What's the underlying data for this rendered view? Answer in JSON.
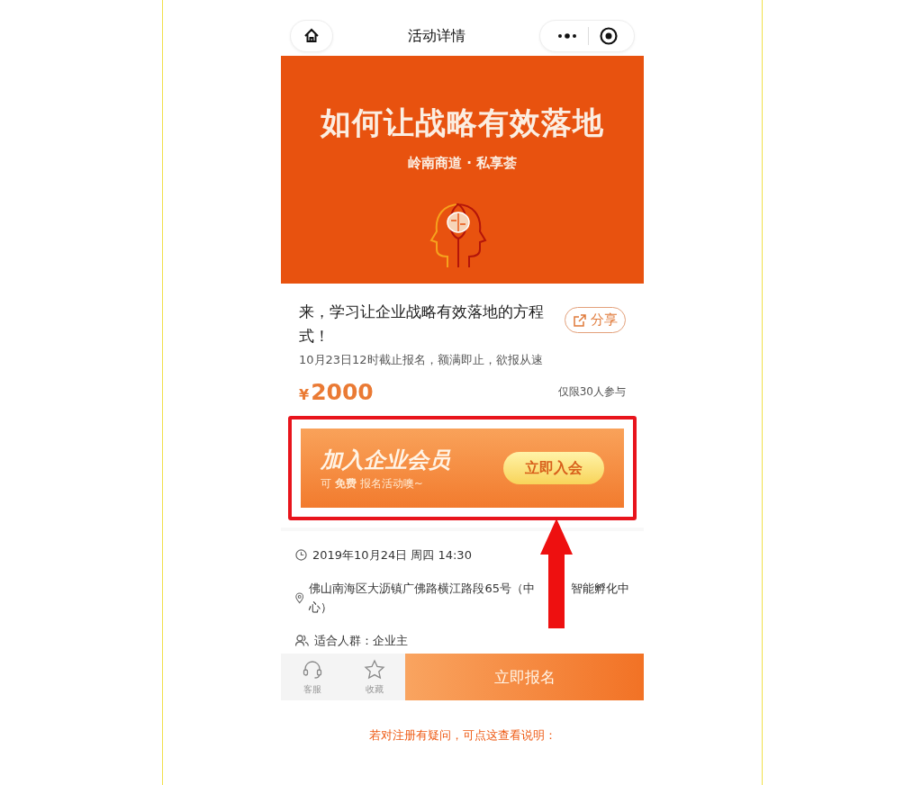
{
  "nav": {
    "title": "活动详情"
  },
  "banner": {
    "title": "如何让战略有效落地",
    "subtitle": "岭南商道 · 私享荟"
  },
  "event": {
    "title": "来，学习让企业战略有效落地的方程式！",
    "share": "分享",
    "deadline": "10月23日12时截止报名，额满即止，欲报从速",
    "currency": "¥",
    "price": "2000",
    "limit": "仅限30人参与"
  },
  "member_promo": {
    "title": "加入企业会员",
    "note": "可 **免费** 报名活动噢~",
    "button": "立即入会",
    "highlighted": true
  },
  "details": [
    {
      "kind": "time",
      "segments": [
        "2019年10月24日 周四 14:30"
      ]
    },
    {
      "kind": "location",
      "segments": [
        "佛山南海区大沥镇广佛路横江路段65号（中",
        "智能孵化中",
        "心）"
      ]
    },
    {
      "kind": "audience",
      "segments": [
        "适合人群：企业主"
      ]
    }
  ],
  "arrow": true,
  "bottom_bar": {
    "actions": [
      {
        "kind": "service",
        "label": "客服"
      },
      {
        "kind": "favorite",
        "label": "收藏"
      }
    ],
    "primary": "立即报名"
  },
  "footer_note": "若对注册有疑问，可点这查看说明："
}
